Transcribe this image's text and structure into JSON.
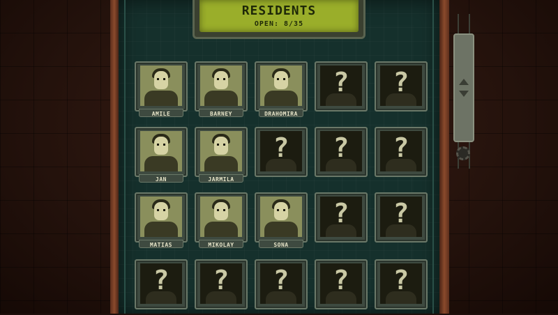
{
  "header": {
    "title": "RESIDENTS",
    "subtitle": "OPEN: 8/35"
  },
  "residents": [
    {
      "name": "AMILE",
      "unlocked": true
    },
    {
      "name": "BARNEY",
      "unlocked": true
    },
    {
      "name": "DRAHOMIRA",
      "unlocked": true
    },
    {
      "name": "",
      "unlocked": false
    },
    {
      "name": "",
      "unlocked": false
    },
    {
      "name": "JAN",
      "unlocked": true
    },
    {
      "name": "JARMILA",
      "unlocked": true
    },
    {
      "name": "",
      "unlocked": false
    },
    {
      "name": "",
      "unlocked": false
    },
    {
      "name": "",
      "unlocked": false
    },
    {
      "name": "MATIAS",
      "unlocked": true
    },
    {
      "name": "MIKOLAY",
      "unlocked": true
    },
    {
      "name": "SONA",
      "unlocked": true
    },
    {
      "name": "",
      "unlocked": false
    },
    {
      "name": "",
      "unlocked": false
    },
    {
      "name": "",
      "unlocked": false
    },
    {
      "name": "",
      "unlocked": false
    },
    {
      "name": "",
      "unlocked": false
    },
    {
      "name": "",
      "unlocked": false
    },
    {
      "name": "",
      "unlocked": false
    }
  ],
  "locked_glyph": "?",
  "colors": {
    "screen": "#9aae2a",
    "panel": "#15302c",
    "card_frame": "#3e4a40"
  }
}
